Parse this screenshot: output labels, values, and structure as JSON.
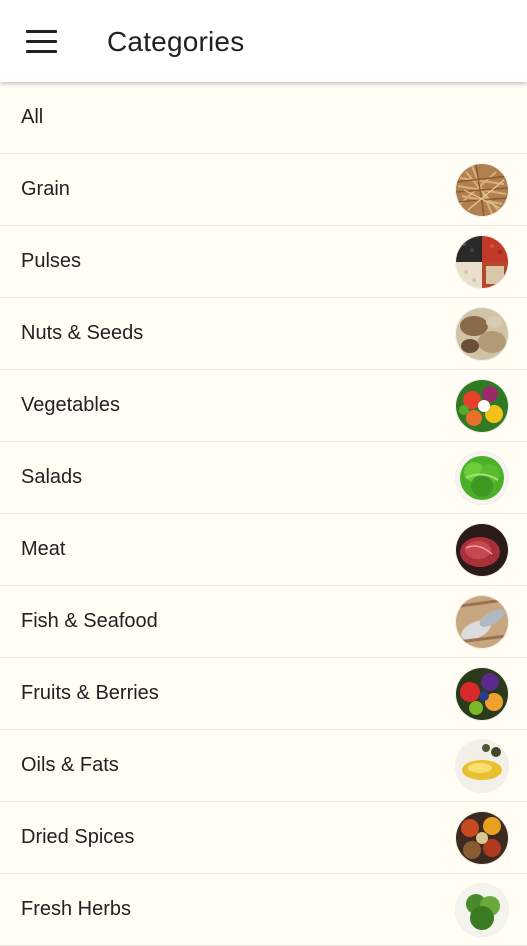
{
  "header": {
    "title": "Categories",
    "menu_icon": "hamburger-menu-icon"
  },
  "categories": [
    {
      "label": "All",
      "image": null
    },
    {
      "label": "Grain",
      "image": "grain-image"
    },
    {
      "label": "Pulses",
      "image": "pulses-image"
    },
    {
      "label": "Nuts & Seeds",
      "image": "nuts-seeds-image"
    },
    {
      "label": "Vegetables",
      "image": "vegetables-image"
    },
    {
      "label": "Salads",
      "image": "salads-image"
    },
    {
      "label": "Meat",
      "image": "meat-image"
    },
    {
      "label": "Fish & Seafood",
      "image": "fish-seafood-image"
    },
    {
      "label": "Fruits & Berries",
      "image": "fruits-berries-image"
    },
    {
      "label": "Oils & Fats",
      "image": "oils-fats-image"
    },
    {
      "label": "Dried Spices",
      "image": "dried-spices-image"
    },
    {
      "label": "Fresh Herbs",
      "image": "fresh-herbs-image"
    }
  ],
  "colors": {
    "background": "#fffdf4",
    "app_bar": "#ffffff",
    "text": "#212121",
    "divider": "#e6e4dc"
  }
}
